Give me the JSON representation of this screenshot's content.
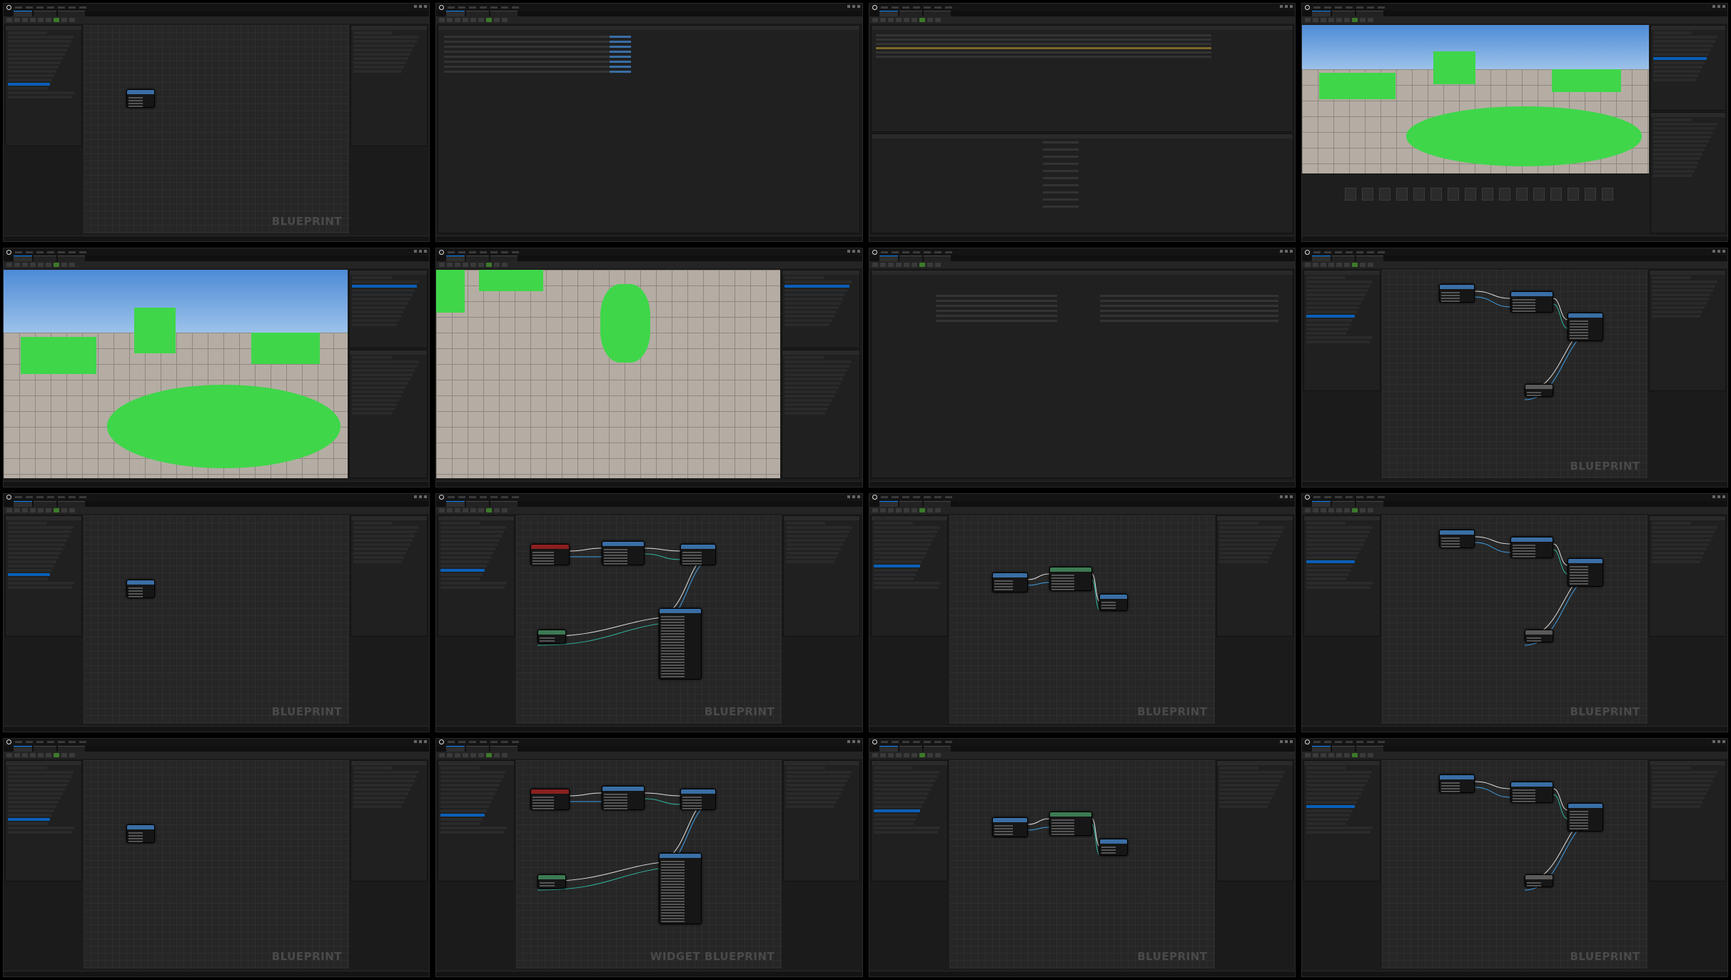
{
  "contact_sheet": {
    "tiles": [
      {
        "id": 1,
        "kind": "blueprint",
        "watermark": "BLUEPRINT"
      },
      {
        "id": 2,
        "kind": "data-table"
      },
      {
        "id": 3,
        "kind": "data-table-rows"
      },
      {
        "id": 4,
        "kind": "level-editor"
      },
      {
        "id": 5,
        "kind": "level-editor"
      },
      {
        "id": 6,
        "kind": "level-editor"
      },
      {
        "id": 7,
        "kind": "struct-editor"
      },
      {
        "id": 8,
        "kind": "blueprint",
        "watermark": "BLUEPRINT"
      },
      {
        "id": 9,
        "kind": "blueprint",
        "watermark": "BLUEPRINT"
      },
      {
        "id": 10,
        "kind": "blueprint",
        "watermark": "BLUEPRINT"
      },
      {
        "id": 11,
        "kind": "blueprint",
        "watermark": "BLUEPRINT"
      },
      {
        "id": 12,
        "kind": "blueprint",
        "watermark": "BLUEPRINT"
      },
      {
        "id": 13,
        "kind": "blueprint",
        "watermark": "BLUEPRINT"
      },
      {
        "id": 14,
        "kind": "widget-blueprint",
        "watermark": "WIDGET BLUEPRINT"
      },
      {
        "id": 15,
        "kind": "blueprint",
        "watermark": "BLUEPRINT"
      },
      {
        "id": 16,
        "kind": "blueprint",
        "watermark": "BLUEPRINT"
      }
    ]
  },
  "colors": {
    "editor_bg": "#1b1b1b",
    "graph_bg": "#262626",
    "selection_blue": "#0a5fb8",
    "level_green": "#3fd64a",
    "floor_grey": "#b5ada4",
    "node_function_blue": "#3a6ea5",
    "node_event_red": "#8b2020",
    "node_pure_green": "#3d7a54",
    "node_macro_grey": "#5a5a5a",
    "wire_exec": "#e0e0e0",
    "wire_data_blue": "#3fa0e8",
    "wire_data_teal": "#2fb8a0"
  },
  "icons": {
    "engine_logo": "unreal-logo-icon",
    "play": "play-icon"
  }
}
